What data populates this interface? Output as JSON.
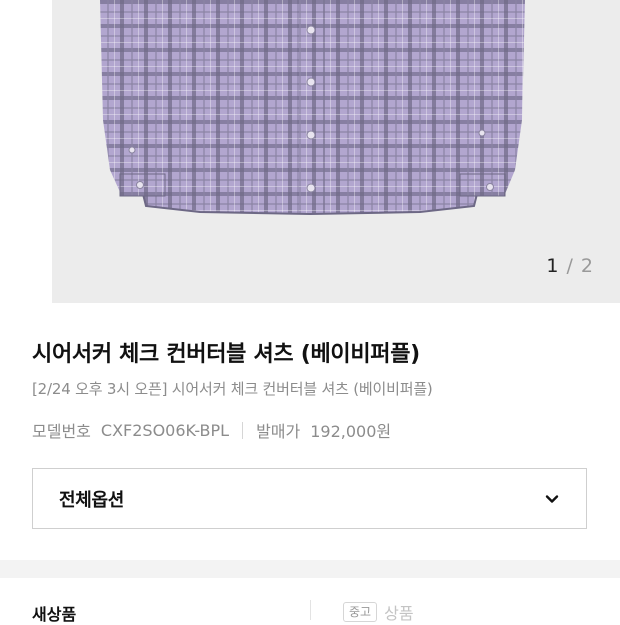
{
  "gallery": {
    "image_name": "purple-check-shirt",
    "colors": {
      "background": "#ececec",
      "shirt_base": "#b2a6cf",
      "shirt_check": "#6f6a86"
    },
    "current": "1",
    "separator": "/",
    "total": "2"
  },
  "product": {
    "title": "시어서커 체크 컨버터블 셔츠 (베이비퍼플)",
    "subtitle": "[2/24 오후 3시 오픈] 시어서커 체크 컨버터블 셔츠 (베이비퍼플)",
    "model_label": "모델번호",
    "model_value": "CXF2SO06K-BPL",
    "price_label": "발매가",
    "price_value": "192,000원"
  },
  "option_select": {
    "label": "전체옵션",
    "icon": "chevron-down-icon"
  },
  "condition": {
    "new_label": "새상품",
    "used_tag": "중고",
    "used_label": "상품"
  }
}
